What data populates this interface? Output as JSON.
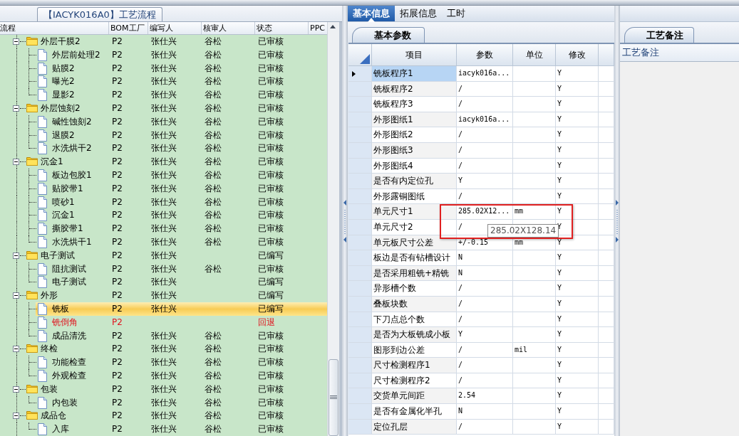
{
  "tree_panel": {
    "title": "【IACYK016A0】工艺流程",
    "columns": [
      "流程",
      "BOM工厂",
      "编写人",
      "核审人",
      "状态",
      "PPC"
    ],
    "rows": [
      {
        "name": "外层干膜2",
        "bom": "P2",
        "writer": "张仕兴",
        "reviewer": "谷松",
        "status": "已审核",
        "selected": false,
        "returned": false,
        "expanded": true,
        "children": [
          {
            "name": "外层前处理2",
            "bom": "P2",
            "writer": "张仕兴",
            "reviewer": "谷松",
            "status": "已审核",
            "selected": false,
            "returned": false
          },
          {
            "name": "贴膜2",
            "bom": "P2",
            "writer": "张仕兴",
            "reviewer": "谷松",
            "status": "已审核",
            "selected": false,
            "returned": false
          },
          {
            "name": "曝光2",
            "bom": "P2",
            "writer": "张仕兴",
            "reviewer": "谷松",
            "status": "已审核",
            "selected": false,
            "returned": false
          },
          {
            "name": "显影2",
            "bom": "P2",
            "writer": "张仕兴",
            "reviewer": "谷松",
            "status": "已审核",
            "selected": false,
            "returned": false
          }
        ]
      },
      {
        "name": "外层蚀刻2",
        "bom": "P2",
        "writer": "张仕兴",
        "reviewer": "谷松",
        "status": "已审核",
        "selected": false,
        "returned": false,
        "expanded": true,
        "children": [
          {
            "name": "碱性蚀刻2",
            "bom": "P2",
            "writer": "张仕兴",
            "reviewer": "谷松",
            "status": "已审核",
            "selected": false,
            "returned": false
          },
          {
            "name": "退膜2",
            "bom": "P2",
            "writer": "张仕兴",
            "reviewer": "谷松",
            "status": "已审核",
            "selected": false,
            "returned": false
          },
          {
            "name": "水洗烘干2",
            "bom": "P2",
            "writer": "张仕兴",
            "reviewer": "谷松",
            "status": "已审核",
            "selected": false,
            "returned": false
          }
        ]
      },
      {
        "name": "沉金1",
        "bom": "P2",
        "writer": "张仕兴",
        "reviewer": "谷松",
        "status": "已审核",
        "selected": false,
        "returned": false,
        "expanded": true,
        "children": [
          {
            "name": "板边包胶1",
            "bom": "P2",
            "writer": "张仕兴",
            "reviewer": "谷松",
            "status": "已审核",
            "selected": false,
            "returned": false
          },
          {
            "name": "贴胶带1",
            "bom": "P2",
            "writer": "张仕兴",
            "reviewer": "谷松",
            "status": "已审核",
            "selected": false,
            "returned": false
          },
          {
            "name": "喷砂1",
            "bom": "P2",
            "writer": "张仕兴",
            "reviewer": "谷松",
            "status": "已审核",
            "selected": false,
            "returned": false
          },
          {
            "name": "沉金1",
            "bom": "P2",
            "writer": "张仕兴",
            "reviewer": "谷松",
            "status": "已审核",
            "selected": false,
            "returned": false
          },
          {
            "name": "撕胶带1",
            "bom": "P2",
            "writer": "张仕兴",
            "reviewer": "谷松",
            "status": "已审核",
            "selected": false,
            "returned": false
          },
          {
            "name": "水洗烘干1",
            "bom": "P2",
            "writer": "张仕兴",
            "reviewer": "谷松",
            "status": "已审核",
            "selected": false,
            "returned": false
          }
        ]
      },
      {
        "name": "电子测试",
        "bom": "P2",
        "writer": "张仕兴",
        "status": "已编写",
        "selected": false,
        "returned": false,
        "expanded": true,
        "children": [
          {
            "name": "阻抗测试",
            "bom": "P2",
            "writer": "张仕兴",
            "reviewer": "谷松",
            "status": "已审核",
            "selected": false,
            "returned": false
          },
          {
            "name": "电子测试",
            "bom": "P2",
            "writer": "张仕兴",
            "status": "已编写",
            "selected": false,
            "returned": false
          }
        ]
      },
      {
        "name": "外形",
        "bom": "P2",
        "writer": "张仕兴",
        "status": "已编写",
        "selected": false,
        "returned": false,
        "expanded": true,
        "children": [
          {
            "name": "铣板",
            "bom": "P2",
            "writer": "张仕兴",
            "status": "已编写",
            "selected": true,
            "returned": false
          },
          {
            "name": "铣倒角",
            "bom": "P2",
            "status": "回退",
            "selected": false,
            "returned": true
          },
          {
            "name": "成品清洗",
            "bom": "P2",
            "writer": "张仕兴",
            "reviewer": "谷松",
            "status": "已审核",
            "selected": false,
            "returned": false
          }
        ]
      },
      {
        "name": "终检",
        "bom": "P2",
        "writer": "张仕兴",
        "reviewer": "谷松",
        "status": "已审核",
        "selected": false,
        "returned": false,
        "expanded": true,
        "children": [
          {
            "name": "功能检查",
            "bom": "P2",
            "writer": "张仕兴",
            "reviewer": "谷松",
            "status": "已审核",
            "selected": false,
            "returned": false
          },
          {
            "name": "外观检查",
            "bom": "P2",
            "writer": "张仕兴",
            "reviewer": "谷松",
            "status": "已审核",
            "selected": false,
            "returned": false
          }
        ]
      },
      {
        "name": "包装",
        "bom": "P2",
        "writer": "张仕兴",
        "reviewer": "谷松",
        "status": "已审核",
        "selected": false,
        "returned": false,
        "expanded": true,
        "children": [
          {
            "name": "内包装",
            "bom": "P2",
            "writer": "张仕兴",
            "reviewer": "谷松",
            "status": "已审核",
            "selected": false,
            "returned": false
          }
        ]
      },
      {
        "name": "成品仓",
        "bom": "P2",
        "writer": "张仕兴",
        "reviewer": "谷松",
        "status": "已审核",
        "selected": false,
        "returned": false,
        "expanded": true,
        "children": [
          {
            "name": "入库",
            "bom": "P2",
            "writer": "张仕兴",
            "reviewer": "谷松",
            "status": "已审核",
            "selected": false,
            "returned": false
          }
        ]
      }
    ]
  },
  "detail_panel": {
    "tabs": [
      {
        "label": "基本信息",
        "selected": true
      },
      {
        "label": "拓展信息",
        "selected": false
      },
      {
        "label": "工时",
        "selected": false
      }
    ],
    "sub_tab": "基本参数",
    "columns": [
      "项目",
      "参数",
      "单位",
      "修改"
    ],
    "rows": [
      {
        "item": "铣板程序1",
        "value": "iacyk016a...",
        "modify": "Y",
        "selected": true
      },
      {
        "item": "铣板程序2",
        "value": "/",
        "modify": "Y",
        "selected": false
      },
      {
        "item": "铣板程序3",
        "value": "/",
        "modify": "Y",
        "selected": false
      },
      {
        "item": "外形图纸1",
        "value": "iacyk016a...",
        "modify": "Y",
        "selected": false
      },
      {
        "item": "外形图纸2",
        "value": "/",
        "modify": "Y",
        "selected": false
      },
      {
        "item": "外形图纸3",
        "value": "/",
        "modify": "Y",
        "selected": false
      },
      {
        "item": "外形图纸4",
        "value": "/",
        "modify": "Y",
        "selected": false
      },
      {
        "item": "是否有内定位孔",
        "value": "Y",
        "modify": "Y",
        "selected": false
      },
      {
        "item": "外形露铜图纸",
        "value": "/",
        "modify": "Y",
        "selected": false
      },
      {
        "item": "单元尺寸1",
        "value": "285.02X12...",
        "unit": "mm",
        "modify": "Y",
        "selected": false
      },
      {
        "item": "单元尺寸2",
        "value": "/",
        "modify": "Y",
        "selected": false
      },
      {
        "item": "单元板尺寸公差",
        "value": "+/-0.15",
        "unit": "mm",
        "modify": "Y",
        "selected": false
      },
      {
        "item": "板边是否有钻槽设计",
        "value": "N",
        "modify": "Y",
        "selected": false
      },
      {
        "item": "是否采用粗铣+精铣",
        "value": "N",
        "modify": "Y",
        "selected": false
      },
      {
        "item": "异形槽个数",
        "value": "/",
        "modify": "Y",
        "selected": false
      },
      {
        "item": "叠板块数",
        "value": "/",
        "modify": "Y",
        "selected": false
      },
      {
        "item": "下刀点总个数",
        "value": "/",
        "modify": "Y",
        "selected": false
      },
      {
        "item": "是否为大板铣成小板",
        "value": "Y",
        "modify": "Y",
        "selected": false
      },
      {
        "item": "图形到边公差",
        "value": "/",
        "unit": "mil",
        "modify": "Y",
        "selected": false
      },
      {
        "item": "尺寸检测程序1",
        "value": "/",
        "modify": "Y",
        "selected": false
      },
      {
        "item": "尺寸检测程序2",
        "value": "/",
        "modify": "Y",
        "selected": false
      },
      {
        "item": "交货单元间距",
        "value": "2.54",
        "modify": "Y",
        "selected": false
      },
      {
        "item": "是否有金属化半孔",
        "value": "N",
        "modify": "Y",
        "selected": false
      },
      {
        "item": "定位孔层",
        "value": "/",
        "modify": "Y",
        "selected": false
      }
    ],
    "tooltip": "285.02X128.14"
  },
  "notes_panel": {
    "tab": "工艺备注",
    "label": "工艺备注"
  }
}
